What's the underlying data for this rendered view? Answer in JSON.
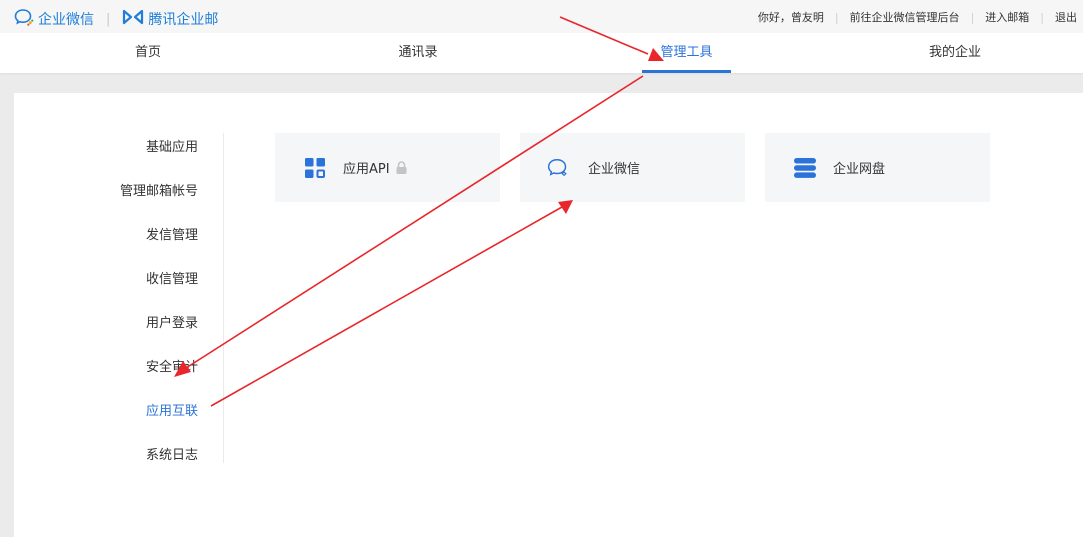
{
  "header": {
    "brand_wecom": "企业微信",
    "brand_exmail": "腾讯企业邮",
    "greeting": "你好，曾友明",
    "link_admin": "前往企业微信管理后台",
    "link_mailbox": "进入邮箱",
    "link_logout": "退出"
  },
  "nav": {
    "tabs": [
      {
        "label": "首页"
      },
      {
        "label": "通讯录"
      },
      {
        "label": "管理工具",
        "active": true
      },
      {
        "label": "我的企业"
      }
    ]
  },
  "sidebar": {
    "items": [
      {
        "label": "基础应用"
      },
      {
        "label": "管理邮箱帐号"
      },
      {
        "label": "发信管理"
      },
      {
        "label": "收信管理"
      },
      {
        "label": "用户登录"
      },
      {
        "label": "安全审计"
      },
      {
        "label": "应用互联",
        "active": true
      },
      {
        "label": "系统日志"
      }
    ]
  },
  "cards": [
    {
      "label": "应用API",
      "icon": "grid-icon",
      "locked": true
    },
    {
      "label": "企业微信",
      "icon": "wecom-chat-icon"
    },
    {
      "label": "企业网盘",
      "icon": "database-icon"
    }
  ],
  "colors": {
    "accent": "#2b73d9",
    "annotation": "#e8262b"
  }
}
